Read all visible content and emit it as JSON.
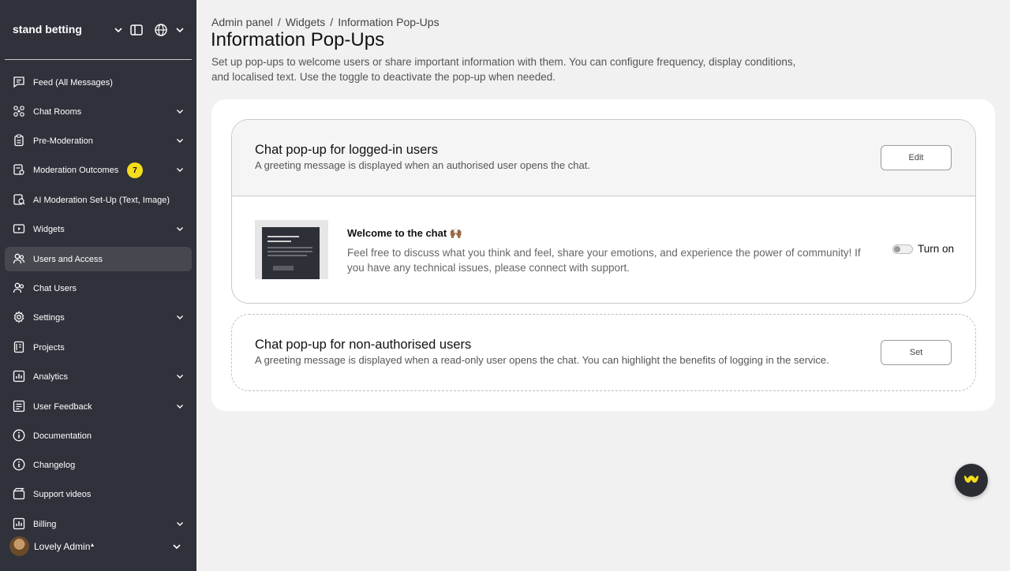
{
  "sidebar": {
    "project_name": "stand betting",
    "items": [
      {
        "label": "Feed (All Messages)",
        "icon": "feed-icon",
        "chevron": false
      },
      {
        "label": "Chat Rooms",
        "icon": "chat-rooms-icon",
        "chevron": true
      },
      {
        "label": "Pre-Moderation",
        "icon": "clipboard-icon",
        "chevron": true
      },
      {
        "label": "Moderation Outcomes",
        "icon": "moderation-icon",
        "chevron": true,
        "badge": "7"
      },
      {
        "label": "AI Moderation Set-Up (Text, Image)",
        "icon": "ai-moderation-icon",
        "chevron": false
      },
      {
        "label": "Widgets",
        "icon": "widgets-icon",
        "chevron": true
      },
      {
        "label": "Users and Access",
        "icon": "users-access-icon",
        "chevron": false,
        "active": true
      },
      {
        "label": "Chat Users",
        "icon": "chat-users-icon",
        "chevron": false
      },
      {
        "label": "Settings",
        "icon": "gear-icon",
        "chevron": true
      },
      {
        "label": "Projects",
        "icon": "projects-icon",
        "chevron": false
      },
      {
        "label": "Analytics",
        "icon": "analytics-icon",
        "chevron": true
      },
      {
        "label": "User Feedback",
        "icon": "feedback-icon",
        "chevron": true
      },
      {
        "label": "Documentation",
        "icon": "info-icon",
        "chevron": false
      },
      {
        "label": "Changelog",
        "icon": "info-icon",
        "chevron": false
      },
      {
        "label": "Support videos",
        "icon": "video-icon",
        "chevron": false
      },
      {
        "label": "Billing",
        "icon": "billing-icon",
        "chevron": true
      }
    ],
    "user": {
      "name": "Lovely Admin",
      "caret": "▴"
    }
  },
  "breadcrumb": [
    "Admin panel",
    "Widgets",
    "Information Pop-Ups"
  ],
  "breadcrumb_separator": "/",
  "page": {
    "title": "Information Pop-Ups",
    "description": "Set up pop-ups to welcome users or share important information with them. You can configure frequency, display conditions, and localised text. Use the toggle to deactivate the pop-up when needed."
  },
  "popup_logged_in": {
    "title": "Chat pop-up for logged-in users",
    "subtitle": "A greeting message is displayed when an authorised user opens the chat.",
    "edit_label": "Edit",
    "message_title": "Welcome to the chat 🙌🏾",
    "message_body": "Feel free to discuss what you think and feel, share your emotions, and experience the power of community! If you have any technical issues, please connect with support.",
    "toggle_label": "Turn on",
    "toggle_on": false
  },
  "popup_non_authorised": {
    "title": "Chat pop-up for non-authorised users",
    "subtitle": "A greeting message is displayed when a read-only user opens the chat. You can highlight the benefits of logging in the service.",
    "set_label": "Set"
  },
  "colors": {
    "sidebar_bg": "#2f323b",
    "badge": "#f4dd1a",
    "fab_logo": "#f4dd1a"
  }
}
